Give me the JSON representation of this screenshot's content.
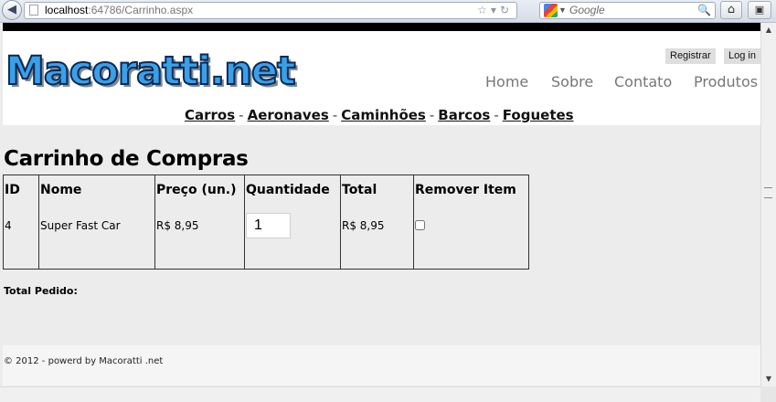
{
  "browser": {
    "url_host": "localhost",
    "url_rest": ":64786/Carrinho.aspx",
    "search_placeholder": "Google"
  },
  "site": {
    "logo_text": "Macoratti.net",
    "auth": {
      "register": "Registrar",
      "login": "Log in"
    },
    "nav": [
      "Home",
      "Sobre",
      "Contato",
      "Produtos"
    ],
    "categories": [
      "Carros",
      "Aeronaves",
      "Caminhões",
      "Barcos",
      "Foguetes"
    ]
  },
  "page": {
    "title": "Carrinho de Compras",
    "table": {
      "headers": [
        "ID",
        "Nome",
        "Preço (un.)",
        "Quantidade",
        "Total",
        "Remover Item"
      ],
      "rows": [
        {
          "id": "4",
          "name": "Super Fast Car",
          "price": "R$ 8,95",
          "quantity": "1",
          "total": "R$ 8,95",
          "remove": false
        }
      ]
    },
    "total_label": "Total Pedido:"
  },
  "footer": {
    "text": "© 2012 - powerd by Macoratti .net"
  }
}
